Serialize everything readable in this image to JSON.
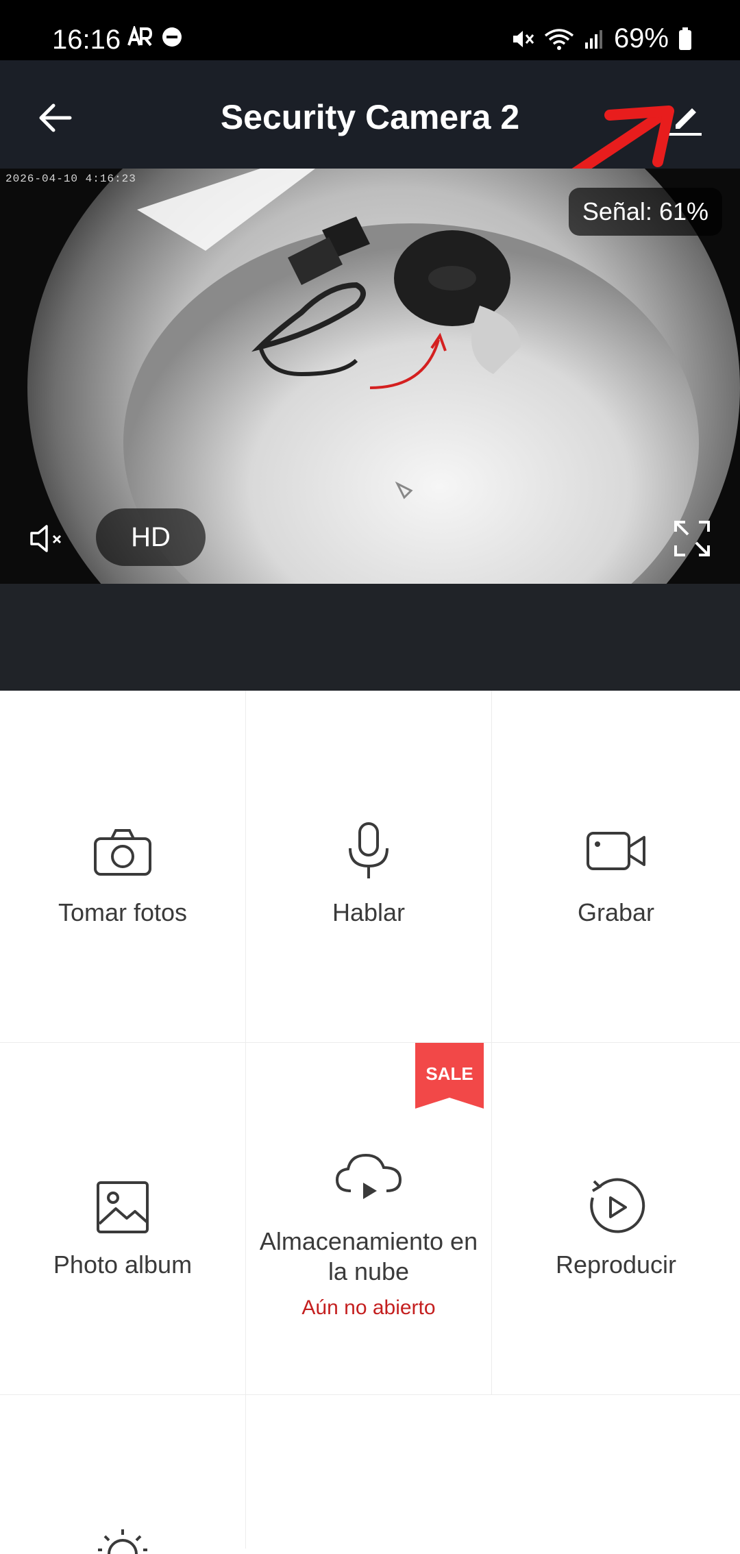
{
  "status_bar": {
    "time": "16:16",
    "battery": "69%"
  },
  "app_bar": {
    "title": "Security Camera 2"
  },
  "video": {
    "timestamp": "2026-04-10  4:16:23",
    "signal_label": "Señal: 61%",
    "quality_label": "HD"
  },
  "functions": [
    {
      "label": "Tomar fotos",
      "icon": "camera-icon"
    },
    {
      "label": "Hablar",
      "icon": "microphone-icon"
    },
    {
      "label": "Grabar",
      "icon": "video-camera-icon"
    },
    {
      "label": "Photo album",
      "icon": "image-icon"
    },
    {
      "label": "Almacenamiento en la nube",
      "sublabel": "Aún no abierto",
      "badge": "SALE",
      "icon": "cloud-play-icon"
    },
    {
      "label": "Reproducir",
      "icon": "playback-icon"
    },
    {
      "icon": "brightness-icon"
    }
  ],
  "colors": {
    "accent_red": "#c41f1f",
    "sale_bg": "#f24848",
    "app_bar_bg": "#1b1f27"
  }
}
